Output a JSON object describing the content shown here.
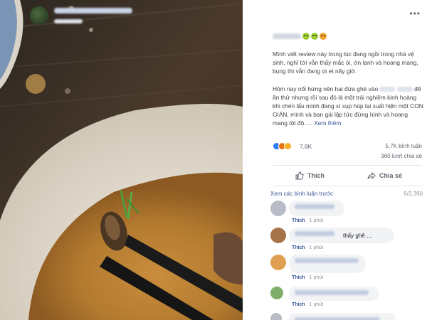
{
  "post": {
    "menu_icon": "more-options-icon",
    "body_paragraphs": [
      "Mình viết review này trong lúc đang ngồi trong nhà vệ sinh, nghĩ tới vẫn thấy mắc ói, ớn lạnh và hoang mang, bụng thì vẫn đang ọt et nãy giờ.",
      "Hôm nay nổi hứng nên hai đứa ghé vào",
      "để ăn thử nhưng rồi sau đó là một trải nghiệm kinh hoàng khi chén lẩu mình đang xì xụp húp lại xuất hiện một CON GIÁN, mình và bạn gái lập tức đứng hình và hoang mang tột độ. ..."
    ],
    "see_more": "Xem thêm",
    "reaction_count": "7,8K",
    "comment_count": "5,7K bình luận",
    "share_count": "360 lượt chia sẻ",
    "like_button": "Thích",
    "share_button": "Chia sẻ",
    "colors": {
      "link": "#385898",
      "like": "#2e7bf6",
      "angry": "#e9710f",
      "wow": "#f7b125"
    }
  },
  "comments": {
    "view_previous": "Xem các bình luận trước",
    "counter": "9/3.390",
    "items": [
      {
        "text": "",
        "like": "Thích",
        "time": "1 phút"
      },
      {
        "text": "thấy ghê ,...",
        "like": "Thích",
        "time": "1 phút"
      },
      {
        "text": "",
        "like": "Thích",
        "time": "1 phút"
      },
      {
        "text": "",
        "like": "Thích",
        "time": "1 phút"
      },
      {
        "text": "",
        "like": "",
        "time": ""
      }
    ]
  }
}
